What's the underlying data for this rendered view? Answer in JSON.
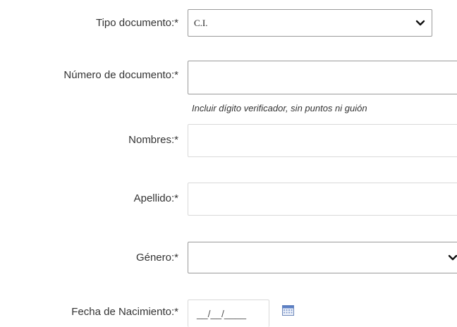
{
  "form": {
    "tipo_documento": {
      "label": "Tipo documento:*",
      "value": "C.I."
    },
    "numero_documento": {
      "label": "Número de documento:*",
      "value": "",
      "hint": "Incluir dígito verificador, sin puntos ni guión"
    },
    "nombres": {
      "label": "Nombres:*",
      "value": ""
    },
    "apellido": {
      "label": "Apellido:*",
      "value": ""
    },
    "genero": {
      "label": "Género:*",
      "value": ""
    },
    "fecha_nacimiento": {
      "label": "Fecha de Nacimiento:*",
      "mask": "__/__/____",
      "icon": "calendar-icon"
    }
  }
}
